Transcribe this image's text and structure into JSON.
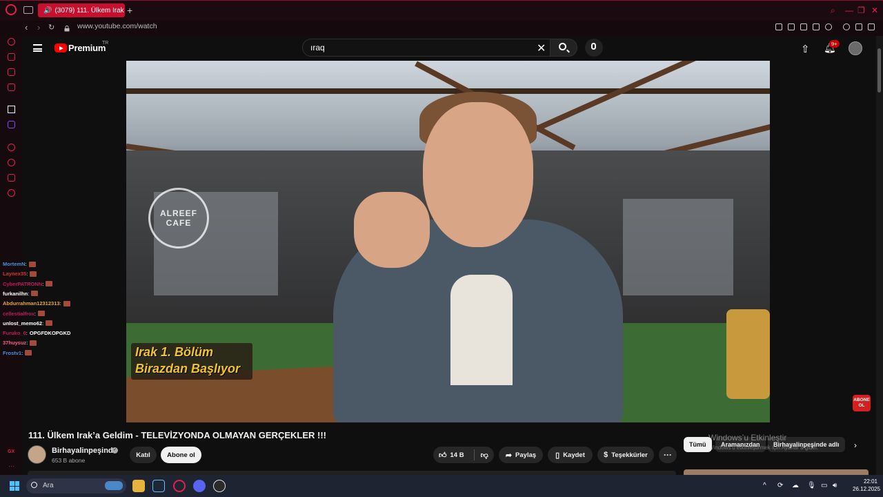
{
  "browser": {
    "tab_title": "(3079) 111. Ülkem Irak",
    "url": "www.youtube.com/watch"
  },
  "youtube": {
    "brand": "Premium",
    "region": "TR",
    "search_value": "ıraq",
    "notifications": "9+"
  },
  "video": {
    "caption_line1": "Irak 1. Bölüm",
    "caption_line2": "Birazdan Başlıyor",
    "cafe_sign": "ALREEF CAFE",
    "subscribe_badge": "ABONE OL",
    "title": "111. Ülkem Irak’a Geldim - TELEVİZYONDA OLMAYAN GERÇEKLER !!!"
  },
  "channel": {
    "name": "Birhayalinpeşinde",
    "subscribers": "653 B abone",
    "join_label": "Katıl",
    "subscribe_label": "Abone ol"
  },
  "actions": {
    "likes": "14 B",
    "share": "Paylaş",
    "save": "Kaydet",
    "thanks": "Teşekkürler"
  },
  "chips": [
    "Tümü",
    "Aramanızdan",
    "Birhayalinpeşinde adlı"
  ],
  "watermark": {
    "line1": "Windows’u Etkinleştir",
    "line2": "Windows’u etkinleştirmek için Ayarlar’a gidin."
  },
  "chat": [
    {
      "user": "MortemN",
      "color": "#4a90e2",
      "msg": ""
    },
    {
      "user": "Laynex35",
      "color": "#d9342b",
      "msg": ""
    },
    {
      "user": "CyberPATRONN",
      "color": "#c2185b",
      "msg": ""
    },
    {
      "user": "furkanilhn",
      "color": "#ffffff",
      "msg": ""
    },
    {
      "user": "Abdurrahman12312313",
      "color": "#e5a83a",
      "msg": ""
    },
    {
      "user": "cellestialfrox",
      "color": "#c2185b",
      "msg": ""
    },
    {
      "user": "unlost_memo62",
      "color": "#ffffff",
      "msg": ""
    },
    {
      "user": "Furuko_0",
      "color": "#c2185b",
      "msg": "OPGFDKOPGKD"
    },
    {
      "user": "37huysuz",
      "color": "#ff5c8a",
      "msg": ""
    },
    {
      "user": "Frostv1",
      "color": "#4a90e2",
      "msg": ""
    }
  ],
  "taskbar": {
    "search_placeholder": "Ara",
    "time": "22:01",
    "date": "26.12.2025"
  },
  "colors": {
    "opera_red": "#e0224a",
    "youtube_red": "#ff0000",
    "caption_yellow": "#f1c232"
  }
}
